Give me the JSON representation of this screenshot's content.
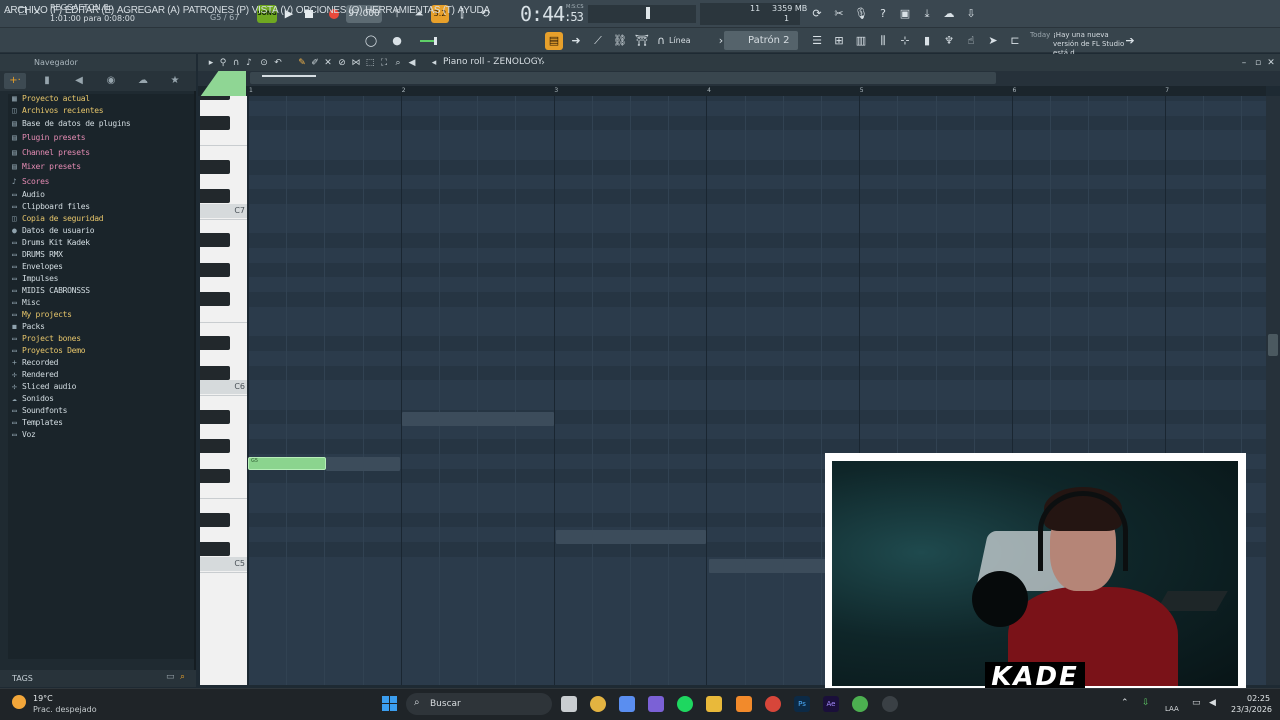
{
  "window": {
    "project_file": "REGGAETON.flp",
    "project_time": "1:01:00 para 0:08:00",
    "note_readout": "G5 / 67"
  },
  "transport": {
    "song_label": "SONG",
    "tempo": "97.000",
    "time_main": "0:44",
    "time_sub": ":53",
    "time_unit": "M:S:CS",
    "metronome_label": "3.2"
  },
  "stats": {
    "cpu": "11",
    "memory": "3359 MB",
    "polyphony": "1"
  },
  "menu": {
    "items": [
      "ARCHIVO (F)",
      "EDITAR (E)",
      "AGREGAR (A)",
      "PATRONES (P)",
      "VISTA (V)",
      "OPCIONES (O)",
      "HERRAMIENTAS (T)",
      "AYUDA"
    ],
    "snap_value": "Línea",
    "pattern_value": "Patrón 2"
  },
  "news": {
    "today_label": "Today",
    "text": "¡Hay una nueva versión de FL Studio está d..."
  },
  "browser": {
    "title": "Navegador",
    "items": [
      {
        "label": "Proyecto actual",
        "color": "#e7c66b",
        "icon": "project-icon"
      },
      {
        "label": "Archivos recientes",
        "color": "#e7c66b",
        "icon": "recent-icon"
      },
      {
        "label": "Base de datos de plugins",
        "color": "#d3dde2",
        "icon": "plugin-db-icon"
      },
      {
        "label": "Plugin presets",
        "color": "#e48bb3",
        "icon": "plugin-presets-icon"
      },
      {
        "label": "Channel presets",
        "color": "#e48bb3",
        "icon": "channel-presets-icon"
      },
      {
        "label": "Mixer presets",
        "color": "#e48bb3",
        "icon": "mixer-presets-icon"
      },
      {
        "label": "Scores",
        "color": "#e48bb3",
        "icon": "scores-icon"
      },
      {
        "label": "Audio",
        "color": "#d3dde2",
        "icon": "folder-icon"
      },
      {
        "label": "Clipboard files",
        "color": "#d3dde2",
        "icon": "folder-icon"
      },
      {
        "label": "Copia de seguridad",
        "color": "#e7c66b",
        "icon": "backup-icon"
      },
      {
        "label": "Datos de usuario",
        "color": "#d3dde2",
        "icon": "user-icon"
      },
      {
        "label": "Drums Kit Kadek",
        "color": "#d3dde2",
        "icon": "folder-icon"
      },
      {
        "label": "DRUMS RMX",
        "color": "#d3dde2",
        "icon": "folder-icon"
      },
      {
        "label": "Envelopes",
        "color": "#d3dde2",
        "icon": "folder-icon"
      },
      {
        "label": "Impulses",
        "color": "#d3dde2",
        "icon": "folder-icon"
      },
      {
        "label": "MIDIS CABRONSSS",
        "color": "#d3dde2",
        "icon": "folder-icon"
      },
      {
        "label": "Misc",
        "color": "#d3dde2",
        "icon": "folder-icon"
      },
      {
        "label": "My projects",
        "color": "#e7c66b",
        "icon": "folder-icon"
      },
      {
        "label": "Packs",
        "color": "#d3dde2",
        "icon": "packs-icon"
      },
      {
        "label": "Project bones",
        "color": "#e7c66b",
        "icon": "folder-icon"
      },
      {
        "label": "Proyectos Demo",
        "color": "#e7c66b",
        "icon": "folder-icon"
      },
      {
        "label": "Recorded",
        "color": "#d3dde2",
        "icon": "recorded-icon"
      },
      {
        "label": "Rendered",
        "color": "#d3dde2",
        "icon": "rendered-icon"
      },
      {
        "label": "Sliced audio",
        "color": "#d3dde2",
        "icon": "sliced-icon"
      },
      {
        "label": "Sonidos",
        "color": "#d3dde2",
        "icon": "cloud-icon"
      },
      {
        "label": "Soundfonts",
        "color": "#d3dde2",
        "icon": "folder-icon"
      },
      {
        "label": "Templates",
        "color": "#d3dde2",
        "icon": "folder-icon"
      },
      {
        "label": "Voz",
        "color": "#d3dde2",
        "icon": "folder-icon"
      }
    ],
    "tags_label": "TAGS"
  },
  "piano_roll": {
    "title": "Piano roll - ZENOLOGY",
    "bars": [
      "1",
      "2",
      "3",
      "4",
      "5",
      "6",
      "7"
    ],
    "octave_labels": [
      "C7",
      "C6",
      "C5"
    ],
    "selected_note_label": "G5"
  },
  "webcam": {
    "label": "KADE"
  },
  "taskbar": {
    "temperature": "19°C",
    "weather": "Prac. despejado",
    "search_label": "Buscar",
    "language": "LAA",
    "time": "02:25",
    "date": "23/3/2026"
  }
}
